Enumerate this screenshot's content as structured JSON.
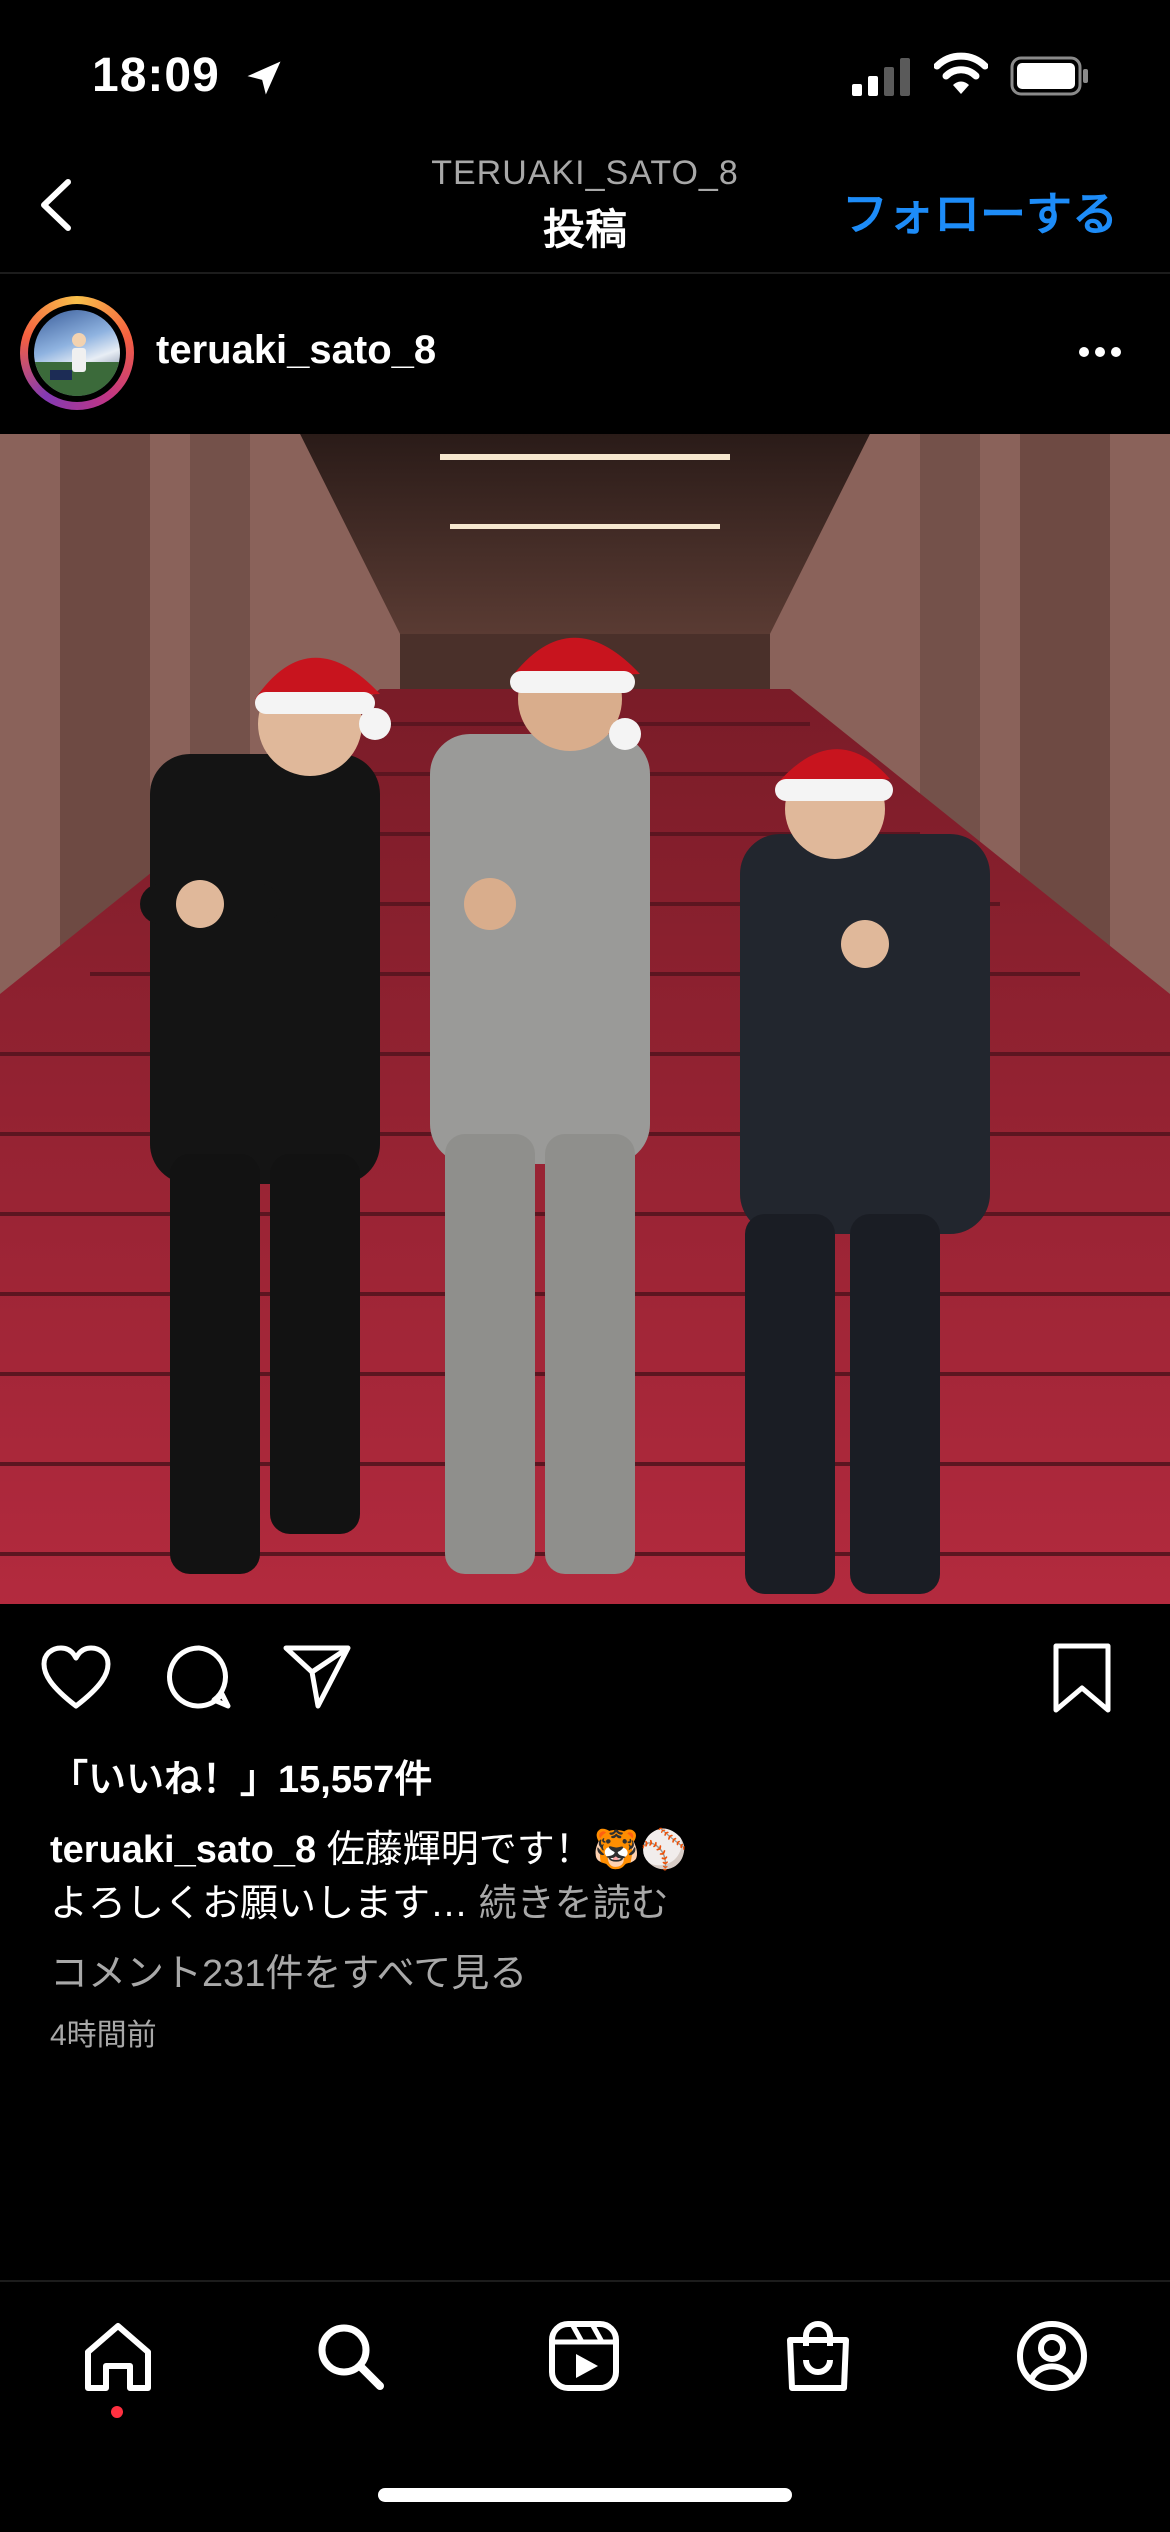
{
  "status_bar": {
    "time": "18:09"
  },
  "header": {
    "username": "TERUAKI_SATO_8",
    "title": "投稿",
    "follow_label": "フォローする"
  },
  "post": {
    "username": "teruaki_sato_8",
    "likes": "「いいね！」15,557件",
    "caption_user": "teruaki_sato_8",
    "caption_text": "佐藤輝明です！🐯⚾",
    "caption_line2": "よろしくお願いします…",
    "read_more": "続きを読む",
    "view_comments": "コメント231件をすべて見る",
    "timestamp": "4時間前"
  },
  "colors": {
    "accent": "#1d8cf8",
    "background": "#000000",
    "secondary_text": "#a8a8a8",
    "notification_dot": "#ff3040"
  },
  "icons": {
    "tabs": [
      "home-icon",
      "search-icon",
      "reels-icon",
      "shop-icon",
      "profile-icon"
    ],
    "actions": [
      "heart-icon",
      "comment-icon",
      "send-icon",
      "bookmark-icon"
    ]
  }
}
